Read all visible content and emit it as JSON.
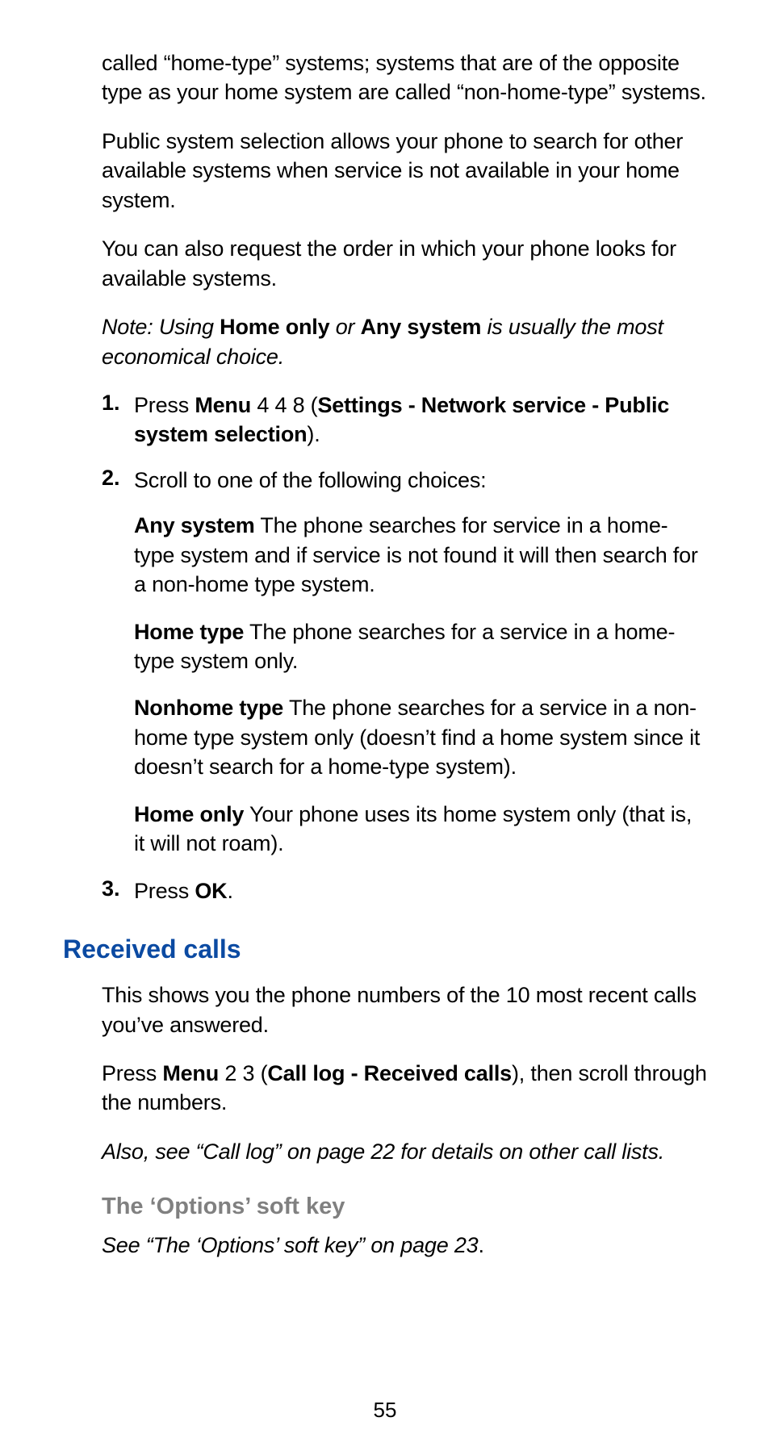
{
  "para1": "called “home-type” systems; systems that are of the opposite type as your home system are called “non-home-type” systems.",
  "para2": "Public system selection allows your phone to search for other available systems when service is not available in your home system.",
  "para3": "You can also request the order in which your phone looks for available systems.",
  "note": {
    "pre": "Note: Using ",
    "b1": "Home only",
    "mid": " or ",
    "b2": "Any system",
    "post": " is usually the most economical choice."
  },
  "steps": {
    "n1": "1.",
    "s1": {
      "a": "Press ",
      "menu": "Menu",
      "b": " 4 4 8 (",
      "path": "Settings - Network service - Public system selection",
      "c": ")."
    },
    "n2": "2.",
    "s2": "Scroll to one of the following choices:",
    "opts": {
      "any": {
        "label": "Any system",
        "text": " The phone searches for service in a home-type system and if service is not found it will then search for a non-home type system."
      },
      "ht": {
        "label": "Home type",
        "text": " The phone searches for a service in a home-type system only."
      },
      "nht": {
        "label": "Nonhome type",
        "text": " The phone searches for a service in a non-home type system only (doesn’t find a home system since it doesn’t search for a home-type system)."
      },
      "ho": {
        "label": "Home only",
        "text": " Your phone uses its home system only (that is, it will not roam)."
      }
    },
    "n3": "3.",
    "s3": {
      "a": "Press ",
      "ok": "OK",
      "b": "."
    }
  },
  "section_received": "Received calls",
  "rec_para": "This shows you the phone numbers of the 10 most recent calls you’ve answered.",
  "rec_step": {
    "a": "Press ",
    "menu": "Menu",
    "b": " 2 3 (",
    "path": "Call log - Received calls",
    "c": "), then scroll through the numbers."
  },
  "also_see": "Also, see “Call log” on page 22 for details on other call lists.",
  "subsection_options": "The ‘Options’ soft key",
  "options_ref_italic": "See “The ‘Options’ soft key” on page 23",
  "options_ref_dot": ".",
  "page_number": "55"
}
